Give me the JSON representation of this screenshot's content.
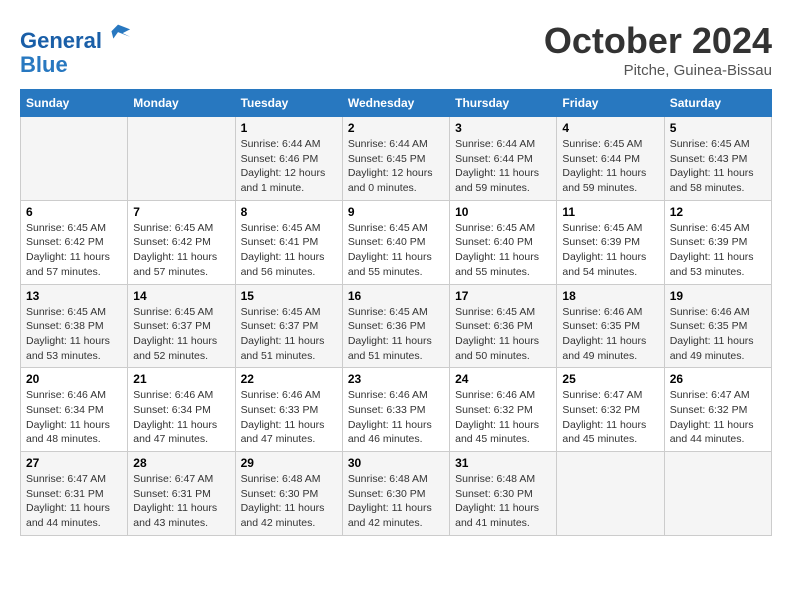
{
  "logo": {
    "line1": "General",
    "line2": "Blue"
  },
  "title": "October 2024",
  "location": "Pitche, Guinea-Bissau",
  "weekdays": [
    "Sunday",
    "Monday",
    "Tuesday",
    "Wednesday",
    "Thursday",
    "Friday",
    "Saturday"
  ],
  "weeks": [
    [
      {
        "day": "",
        "info": ""
      },
      {
        "day": "",
        "info": ""
      },
      {
        "day": "1",
        "info": "Sunrise: 6:44 AM\nSunset: 6:46 PM\nDaylight: 12 hours\nand 1 minute."
      },
      {
        "day": "2",
        "info": "Sunrise: 6:44 AM\nSunset: 6:45 PM\nDaylight: 12 hours\nand 0 minutes."
      },
      {
        "day": "3",
        "info": "Sunrise: 6:44 AM\nSunset: 6:44 PM\nDaylight: 11 hours\nand 59 minutes."
      },
      {
        "day": "4",
        "info": "Sunrise: 6:45 AM\nSunset: 6:44 PM\nDaylight: 11 hours\nand 59 minutes."
      },
      {
        "day": "5",
        "info": "Sunrise: 6:45 AM\nSunset: 6:43 PM\nDaylight: 11 hours\nand 58 minutes."
      }
    ],
    [
      {
        "day": "6",
        "info": "Sunrise: 6:45 AM\nSunset: 6:42 PM\nDaylight: 11 hours\nand 57 minutes."
      },
      {
        "day": "7",
        "info": "Sunrise: 6:45 AM\nSunset: 6:42 PM\nDaylight: 11 hours\nand 57 minutes."
      },
      {
        "day": "8",
        "info": "Sunrise: 6:45 AM\nSunset: 6:41 PM\nDaylight: 11 hours\nand 56 minutes."
      },
      {
        "day": "9",
        "info": "Sunrise: 6:45 AM\nSunset: 6:40 PM\nDaylight: 11 hours\nand 55 minutes."
      },
      {
        "day": "10",
        "info": "Sunrise: 6:45 AM\nSunset: 6:40 PM\nDaylight: 11 hours\nand 55 minutes."
      },
      {
        "day": "11",
        "info": "Sunrise: 6:45 AM\nSunset: 6:39 PM\nDaylight: 11 hours\nand 54 minutes."
      },
      {
        "day": "12",
        "info": "Sunrise: 6:45 AM\nSunset: 6:39 PM\nDaylight: 11 hours\nand 53 minutes."
      }
    ],
    [
      {
        "day": "13",
        "info": "Sunrise: 6:45 AM\nSunset: 6:38 PM\nDaylight: 11 hours\nand 53 minutes."
      },
      {
        "day": "14",
        "info": "Sunrise: 6:45 AM\nSunset: 6:37 PM\nDaylight: 11 hours\nand 52 minutes."
      },
      {
        "day": "15",
        "info": "Sunrise: 6:45 AM\nSunset: 6:37 PM\nDaylight: 11 hours\nand 51 minutes."
      },
      {
        "day": "16",
        "info": "Sunrise: 6:45 AM\nSunset: 6:36 PM\nDaylight: 11 hours\nand 51 minutes."
      },
      {
        "day": "17",
        "info": "Sunrise: 6:45 AM\nSunset: 6:36 PM\nDaylight: 11 hours\nand 50 minutes."
      },
      {
        "day": "18",
        "info": "Sunrise: 6:46 AM\nSunset: 6:35 PM\nDaylight: 11 hours\nand 49 minutes."
      },
      {
        "day": "19",
        "info": "Sunrise: 6:46 AM\nSunset: 6:35 PM\nDaylight: 11 hours\nand 49 minutes."
      }
    ],
    [
      {
        "day": "20",
        "info": "Sunrise: 6:46 AM\nSunset: 6:34 PM\nDaylight: 11 hours\nand 48 minutes."
      },
      {
        "day": "21",
        "info": "Sunrise: 6:46 AM\nSunset: 6:34 PM\nDaylight: 11 hours\nand 47 minutes."
      },
      {
        "day": "22",
        "info": "Sunrise: 6:46 AM\nSunset: 6:33 PM\nDaylight: 11 hours\nand 47 minutes."
      },
      {
        "day": "23",
        "info": "Sunrise: 6:46 AM\nSunset: 6:33 PM\nDaylight: 11 hours\nand 46 minutes."
      },
      {
        "day": "24",
        "info": "Sunrise: 6:46 AM\nSunset: 6:32 PM\nDaylight: 11 hours\nand 45 minutes."
      },
      {
        "day": "25",
        "info": "Sunrise: 6:47 AM\nSunset: 6:32 PM\nDaylight: 11 hours\nand 45 minutes."
      },
      {
        "day": "26",
        "info": "Sunrise: 6:47 AM\nSunset: 6:32 PM\nDaylight: 11 hours\nand 44 minutes."
      }
    ],
    [
      {
        "day": "27",
        "info": "Sunrise: 6:47 AM\nSunset: 6:31 PM\nDaylight: 11 hours\nand 44 minutes."
      },
      {
        "day": "28",
        "info": "Sunrise: 6:47 AM\nSunset: 6:31 PM\nDaylight: 11 hours\nand 43 minutes."
      },
      {
        "day": "29",
        "info": "Sunrise: 6:48 AM\nSunset: 6:30 PM\nDaylight: 11 hours\nand 42 minutes."
      },
      {
        "day": "30",
        "info": "Sunrise: 6:48 AM\nSunset: 6:30 PM\nDaylight: 11 hours\nand 42 minutes."
      },
      {
        "day": "31",
        "info": "Sunrise: 6:48 AM\nSunset: 6:30 PM\nDaylight: 11 hours\nand 41 minutes."
      },
      {
        "day": "",
        "info": ""
      },
      {
        "day": "",
        "info": ""
      }
    ]
  ]
}
